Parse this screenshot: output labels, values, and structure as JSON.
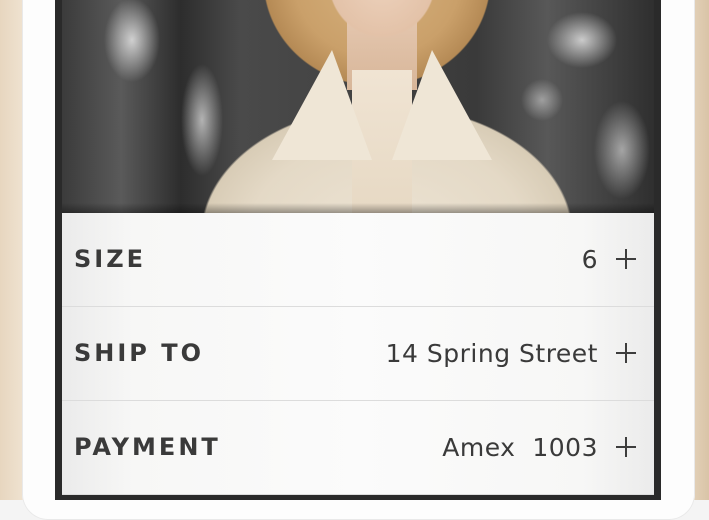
{
  "product": {
    "image_alt": "model wearing cream leather jacket"
  },
  "options": [
    {
      "label": "SIZE",
      "value": "6",
      "action_icon": "plus-icon"
    },
    {
      "label": "SHIP TO",
      "value": "14 Spring Street",
      "action_icon": "plus-icon"
    },
    {
      "label": "PAYMENT",
      "value": "Amex  1003",
      "action_icon": "plus-icon"
    }
  ],
  "colors": {
    "row_text": "#3a3a3a",
    "row_background": "#fbfbfb",
    "divider": "#dcdcdc",
    "screen_border": "#2a2a2a",
    "phone_frame_gold": "#f1e5d4"
  }
}
